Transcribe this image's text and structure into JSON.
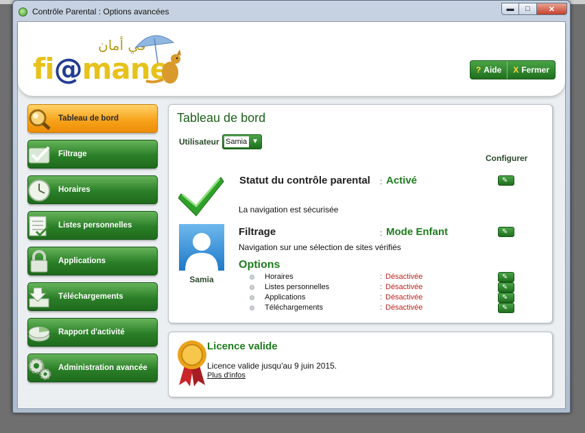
{
  "window": {
    "title": "Contrôle Parental : Options avancées",
    "controls": {
      "minimize": "▬",
      "maximize": "□",
      "close": "✕"
    }
  },
  "header": {
    "logo_parts": {
      "fi": "fi",
      "at": "@",
      "mane": "mane",
      "arabic": "في أمان"
    },
    "help_button": {
      "icon": "?",
      "label": "Aide"
    },
    "close_button": {
      "icon": "X",
      "label": "Fermer"
    }
  },
  "sidebar": {
    "items": [
      {
        "label": "Tableau de bord",
        "icon": "magnifier-icon",
        "active": true
      },
      {
        "label": "Filtrage",
        "icon": "check-icon",
        "active": false
      },
      {
        "label": "Horaires",
        "icon": "clock-icon",
        "active": false
      },
      {
        "label": "Listes personnelles",
        "icon": "list-icon",
        "active": false
      },
      {
        "label": "Applications",
        "icon": "lock-icon",
        "active": false
      },
      {
        "label": "Téléchargements",
        "icon": "download-icon",
        "active": false
      },
      {
        "label": "Rapport d'activité",
        "icon": "report-icon",
        "active": false
      },
      {
        "label": "Administration avancée",
        "icon": "gears-icon",
        "active": false
      }
    ]
  },
  "dashboard": {
    "title": "Tableau de bord",
    "user_label": "Utilisateur",
    "user_value": "Samia",
    "configure_header": "Configurer",
    "avatar_name": "Samia",
    "status": {
      "label": "Statut du contrôle parental",
      "value": "Activé",
      "description": "La navigation est sécurisée"
    },
    "filtering": {
      "label": "Filtrage",
      "value": "Mode Enfant",
      "description": "Navigation sur une sélection de sites vérifiés"
    },
    "options": {
      "title": "Options",
      "rows": [
        {
          "name": "Horaires",
          "state": "Désactivée"
        },
        {
          "name": "Listes personnelles",
          "state": "Désactivée"
        },
        {
          "name": "Applications",
          "state": "Désactivée"
        },
        {
          "name": "Téléchargements",
          "state": "Désactivée"
        }
      ]
    },
    "colon": ":",
    "configure_icon": "wrench-icon"
  },
  "licence": {
    "title": "Licence valide",
    "text": "Licence valide jusqu'au 9 juin 2015.",
    "link": "Plus d'infos"
  },
  "colors": {
    "green_dark": "#1f6f1d",
    "green_text": "#1d7c1d",
    "orange_active": "#f7a41c",
    "red_state": "#c0221d"
  }
}
